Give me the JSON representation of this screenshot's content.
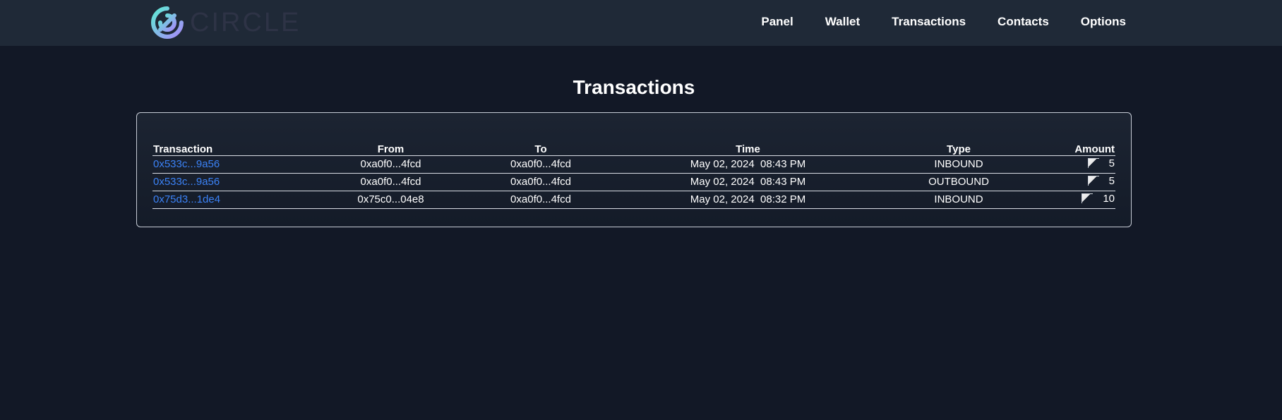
{
  "header": {
    "logo_text": "CIRCLE",
    "nav": [
      "Panel",
      "Wallet",
      "Transactions",
      "Contacts",
      "Options"
    ]
  },
  "page": {
    "title": "Transactions"
  },
  "table": {
    "columns": [
      "Transaction",
      "From",
      "To",
      "Time",
      "Type",
      "Amount"
    ],
    "rows": [
      {
        "tx": "0x533c...9a56",
        "from": "0xa0f0...4fcd",
        "to": "0xa0f0...4fcd",
        "time": "May 02, 2024  08:43 PM",
        "type": "INBOUND",
        "amount": "5"
      },
      {
        "tx": "0x533c...9a56",
        "from": "0xa0f0...4fcd",
        "to": "0xa0f0...4fcd",
        "time": "May 02, 2024  08:43 PM",
        "type": "OUTBOUND",
        "amount": "5"
      },
      {
        "tx": "0x75d3...1de4",
        "from": "0x75c0...04e8",
        "to": "0xa0f0...4fcd",
        "time": "May 02, 2024  08:32 PM",
        "type": "INBOUND",
        "amount": "10"
      }
    ]
  },
  "colors": {
    "background": "#121826",
    "navbar": "#1f2937",
    "link": "#3b82f6",
    "logo_gradient": [
      "#5eead4",
      "#a78bfa"
    ]
  },
  "icons": {
    "logo": "circle-logo-icon",
    "amount_token": "token-image-icon"
  }
}
